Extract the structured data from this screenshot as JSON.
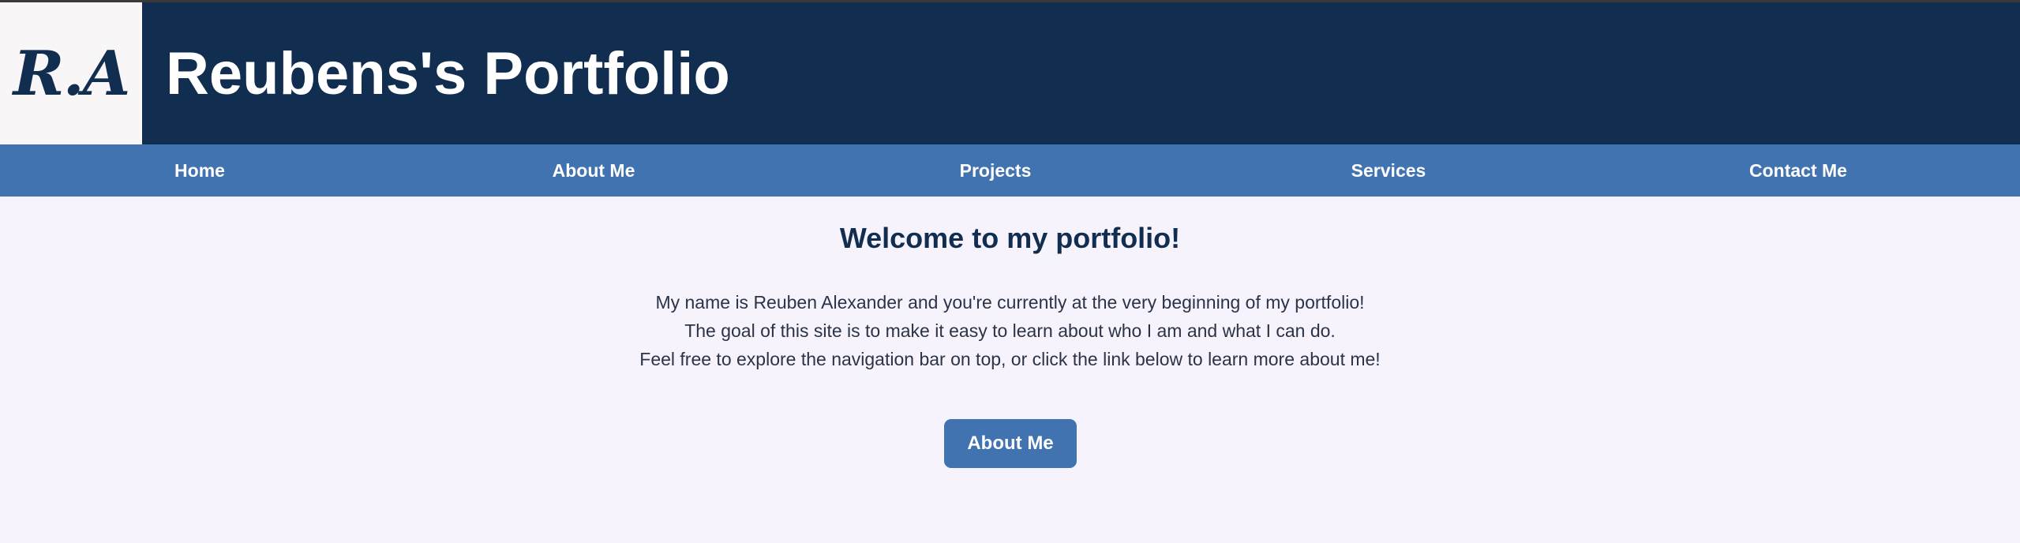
{
  "header": {
    "logo_text": "R.A",
    "title": "Reubens's Portfolio"
  },
  "nav": {
    "items": [
      {
        "label": "Home"
      },
      {
        "label": "About Me"
      },
      {
        "label": "Projects"
      },
      {
        "label": "Services"
      },
      {
        "label": "Contact Me"
      }
    ]
  },
  "main": {
    "heading": "Welcome to my portfolio!",
    "paragraph_lines": [
      "My name is Reuben Alexander and you're currently at the very beginning of my portfolio!",
      "The goal of this site is to make it easy to learn about who I am and what I can do.",
      "Feel free to explore the navigation bar on top, or click the link below to learn more about me!"
    ],
    "cta_label": "About Me"
  },
  "colors": {
    "header_bg": "#112d50",
    "nav_bg": "#4173b1",
    "page_bg": "#f6f3fc",
    "logo_bg": "#f8f6f6",
    "button_bg": "#4173b1"
  }
}
